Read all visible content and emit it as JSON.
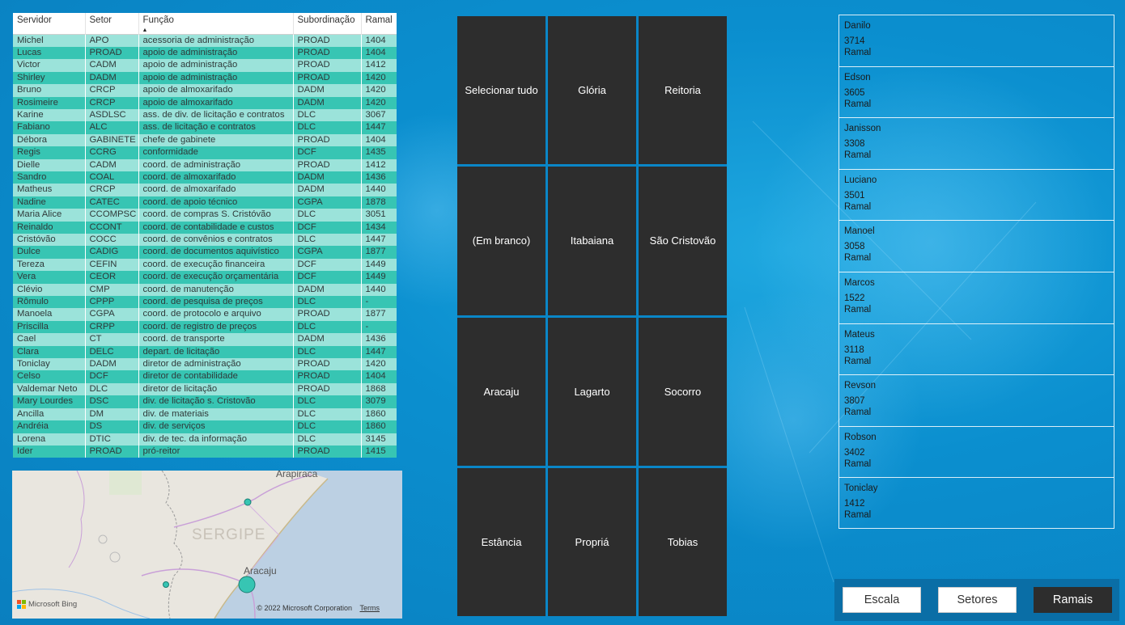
{
  "table": {
    "columns": [
      "Servidor",
      "Setor",
      "Função",
      "Subordinação",
      "Ramal"
    ],
    "sort_column": "Função",
    "rows": [
      [
        "Michel",
        "APO",
        "acessoria de administração",
        "PROAD",
        "1404"
      ],
      [
        "Lucas",
        "PROAD",
        "apoio de administração",
        "PROAD",
        "1404"
      ],
      [
        "Victor",
        "CADM",
        "apoio de administração",
        "PROAD",
        "1412"
      ],
      [
        "Shirley",
        "DADM",
        "apoio de administração",
        "PROAD",
        "1420"
      ],
      [
        "Bruno",
        "CRCP",
        "apoio de almoxarifado",
        "DADM",
        "1420"
      ],
      [
        "Rosimeire",
        "CRCP",
        "apoio de almoxarifado",
        "DADM",
        "1420"
      ],
      [
        "Karine",
        "ASDLSC",
        "ass. de div. de licitação e contratos",
        "DLC",
        "3067"
      ],
      [
        "Fabiano",
        "ALC",
        "ass. de licitação e contratos",
        "DLC",
        "1447"
      ],
      [
        "Débora",
        "GABINETE",
        "chefe de gabinete",
        "PROAD",
        "1404"
      ],
      [
        "Regis",
        "CCRG",
        "conformidade",
        "DCF",
        "1435"
      ],
      [
        "Dielle",
        "CADM",
        "coord. de administração",
        "PROAD",
        "1412"
      ],
      [
        "Sandro",
        "COAL",
        "coord. de almoxarifado",
        "DADM",
        "1436"
      ],
      [
        "Matheus",
        "CRCP",
        "coord. de almoxarifado",
        "DADM",
        "1440"
      ],
      [
        "Nadine",
        "CATEC",
        "coord. de apoio técnico",
        "CGPA",
        "1878"
      ],
      [
        "Maria Alice",
        "CCOMPSC",
        "coord. de compras S. Cristóvão",
        "DLC",
        "3051"
      ],
      [
        "Reinaldo",
        "CCONT",
        "coord. de contabilidade e custos",
        "DCF",
        "1434"
      ],
      [
        "Cristóvão",
        "COCC",
        "coord. de convênios e contratos",
        "DLC",
        "1447"
      ],
      [
        "Dulce",
        "CADIG",
        "coord. de documentos aquivístico",
        "CGPA",
        "1877"
      ],
      [
        "Tereza",
        "CEFIN",
        "coord. de execução financeira",
        "DCF",
        "1449"
      ],
      [
        "Vera",
        "CEOR",
        "coord. de execução orçamentária",
        "DCF",
        "1449"
      ],
      [
        "Clévio",
        "CMP",
        "coord. de manutenção",
        "DADM",
        "1440"
      ],
      [
        "Rômulo",
        "CPPP",
        "coord. de pesquisa de preços",
        "DLC",
        "-"
      ],
      [
        "Manoela",
        "CGPA",
        "coord. de protocolo e arquivo",
        "PROAD",
        "1877"
      ],
      [
        "Priscilla",
        "CRPP",
        "coord. de registro de preços",
        "DLC",
        "-"
      ],
      [
        "Cael",
        "CT",
        "coord. de transporte",
        "DADM",
        "1436"
      ],
      [
        "Clara",
        "DELC",
        "depart. de licitação",
        "DLC",
        "1447"
      ],
      [
        "Toniclay",
        "DADM",
        "diretor de administração",
        "PROAD",
        "1420"
      ],
      [
        "Celso",
        "DCF",
        "diretor de contabilidade",
        "PROAD",
        "1404"
      ],
      [
        "Valdemar Neto",
        "DLC",
        "diretor de licitação",
        "PROAD",
        "1868"
      ],
      [
        "Mary Lourdes",
        "DSC",
        "div. de licitação s. Cristovão",
        "DLC",
        "3079"
      ],
      [
        "Ancilla",
        "DM",
        "div. de materiais",
        "DLC",
        "1860"
      ],
      [
        "Andréia",
        "DS",
        "div. de serviços",
        "DLC",
        "1860"
      ],
      [
        "Lorena",
        "DTIC",
        "div. de tec. da informação",
        "DLC",
        "3145"
      ],
      [
        "Ider",
        "PROAD",
        "pró-reitor",
        "PROAD",
        "1415"
      ]
    ]
  },
  "map": {
    "state_label": "SERGIPE",
    "city_top": "Arapiraca",
    "city_main": "Aracaju",
    "provider": "Microsoft Bing",
    "copyright": "© 2022 Microsoft Corporation",
    "terms": "Terms"
  },
  "tiles": [
    "Selecionar tudo",
    "Glória",
    "Reitoria",
    "(Em branco)",
    "Itabaiana",
    "São Cristovão",
    "Aracaju",
    "Lagarto",
    "Socorro",
    "Estância",
    "Propriá",
    "Tobias"
  ],
  "ramais": [
    {
      "name": "Danilo",
      "ramal": "3714",
      "label": "Ramal"
    },
    {
      "name": "Edson",
      "ramal": "3605",
      "label": "Ramal"
    },
    {
      "name": "Janisson",
      "ramal": "3308",
      "label": "Ramal"
    },
    {
      "name": "Luciano",
      "ramal": "3501",
      "label": "Ramal"
    },
    {
      "name": "Manoel",
      "ramal": "3058",
      "label": "Ramal"
    },
    {
      "name": "Marcos",
      "ramal": "1522",
      "label": "Ramal"
    },
    {
      "name": "Mateus",
      "ramal": "3118",
      "label": "Ramal"
    },
    {
      "name": "Revson",
      "ramal": "3807",
      "label": "Ramal"
    },
    {
      "name": "Robson",
      "ramal": "3402",
      "label": "Ramal"
    },
    {
      "name": "Toniclay",
      "ramal": "1412",
      "label": "Ramal"
    }
  ],
  "nav": {
    "buttons": [
      "Escala",
      "Setores",
      "Ramais"
    ],
    "active": "Ramais"
  },
  "colors": {
    "row_light": "#9be3da",
    "row_dark": "#37c5b3",
    "tile_bg": "#2d2d2d",
    "background": "#0b8fcf"
  }
}
